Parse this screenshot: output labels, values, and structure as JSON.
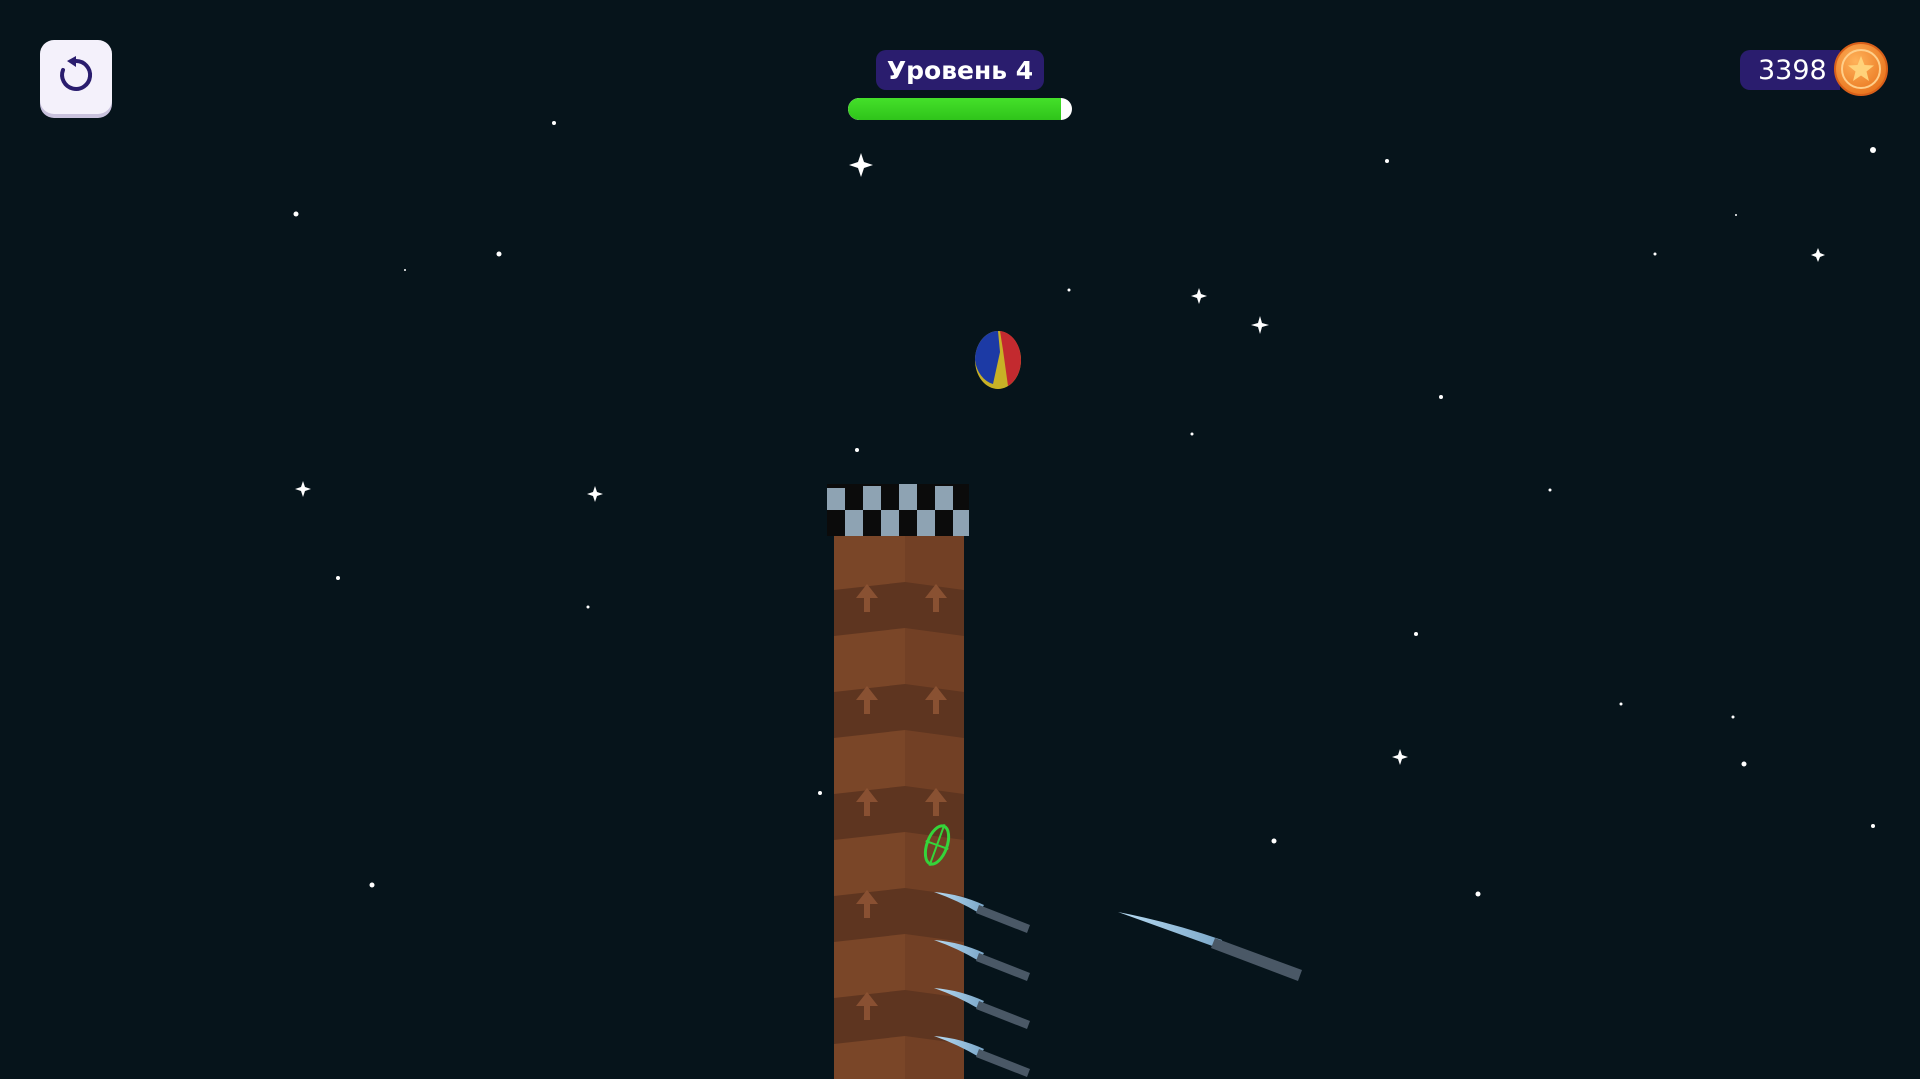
{
  "hud": {
    "restart_icon": "restart-icon",
    "level_label": "Уровень 4",
    "level_progress": 0.95,
    "coins": "3398",
    "coin_icon": "star-coin-icon"
  },
  "colors": {
    "background": "#06141b",
    "badge": "#2a1d6e",
    "progress": "#3fd625",
    "tower": "#7a4628",
    "knife_blade": "#9fc6e4",
    "target": "#35d43a"
  }
}
